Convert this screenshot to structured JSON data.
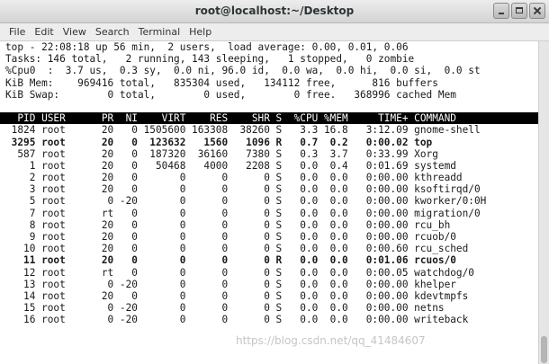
{
  "window": {
    "title": "root@localhost:~/Desktop"
  },
  "menu": [
    "File",
    "Edit",
    "View",
    "Search",
    "Terminal",
    "Help"
  ],
  "summary": [
    "top - 22:08:18 up 56 min,  2 users,  load average: 0.00, 0.01, 0.06",
    "Tasks: 146 total,   2 running, 143 sleeping,   1 stopped,   0 zombie",
    "%Cpu0  :  3.7 us,  0.3 sy,  0.0 ni, 96.0 id,  0.0 wa,  0.0 hi,  0.0 si,  0.0 st",
    "KiB Mem:    969416 total,   835304 used,   134112 free,      816 buffers",
    "KiB Swap:        0 total,        0 used,        0 free.   368996 cached Mem"
  ],
  "process_header": "  PID USER      PR  NI    VIRT    RES    SHR S  %CPU %MEM     TIME+ COMMAND     ",
  "processes": [
    {
      "text": " 1824 root      20   0 1505600 163308  38260 S   3.3 16.8   3:12.09 gnome-shell",
      "bold": false
    },
    {
      "text": " 3295 root      20   0  123632   1560   1096 R   0.7  0.2   0:00.02 top",
      "bold": true
    },
    {
      "text": "  587 root      20   0  187320  36160   7380 S   0.3  3.7   0:33.99 Xorg",
      "bold": false
    },
    {
      "text": "    1 root      20   0   50468   4000   2208 S   0.0  0.4   0:01.69 systemd",
      "bold": false
    },
    {
      "text": "    2 root      20   0       0      0      0 S   0.0  0.0   0:00.00 kthreadd",
      "bold": false
    },
    {
      "text": "    3 root      20   0       0      0      0 S   0.0  0.0   0:00.00 ksoftirqd/0",
      "bold": false
    },
    {
      "text": "    5 root       0 -20       0      0      0 S   0.0  0.0   0:00.00 kworker/0:0H",
      "bold": false
    },
    {
      "text": "    7 root      rt   0       0      0      0 S   0.0  0.0   0:00.00 migration/0",
      "bold": false
    },
    {
      "text": "    8 root      20   0       0      0      0 S   0.0  0.0   0:00.00 rcu_bh",
      "bold": false
    },
    {
      "text": "    9 root      20   0       0      0      0 S   0.0  0.0   0:00.00 rcuob/0",
      "bold": false
    },
    {
      "text": "   10 root      20   0       0      0      0 S   0.0  0.0   0:00.60 rcu_sched",
      "bold": false
    },
    {
      "text": "   11 root      20   0       0      0      0 R   0.0  0.0   0:01.06 rcuos/0",
      "bold": true
    },
    {
      "text": "   12 root      rt   0       0      0      0 S   0.0  0.0   0:00.05 watchdog/0",
      "bold": false
    },
    {
      "text": "   13 root       0 -20       0      0      0 S   0.0  0.0   0:00.00 khelper",
      "bold": false
    },
    {
      "text": "   14 root      20   0       0      0      0 S   0.0  0.0   0:00.00 kdevtmpfs",
      "bold": false
    },
    {
      "text": "   15 root       0 -20       0      0      0 S   0.0  0.0   0:00.00 netns",
      "bold": false
    },
    {
      "text": "   16 root       0 -20       0      0      0 S   0.0  0.0   0:00.00 writeback",
      "bold": false
    }
  ],
  "watermark": "https://blog.csdn.net/qq_41484607",
  "colors": {
    "header_bg": "#000000",
    "header_fg": "#ffffff",
    "terminal_bg": "#ffffff",
    "terminal_fg": "#1a1a1a"
  },
  "icons": {
    "minimize": "minimize-icon",
    "maximize": "maximize-icon",
    "close": "close-icon"
  }
}
